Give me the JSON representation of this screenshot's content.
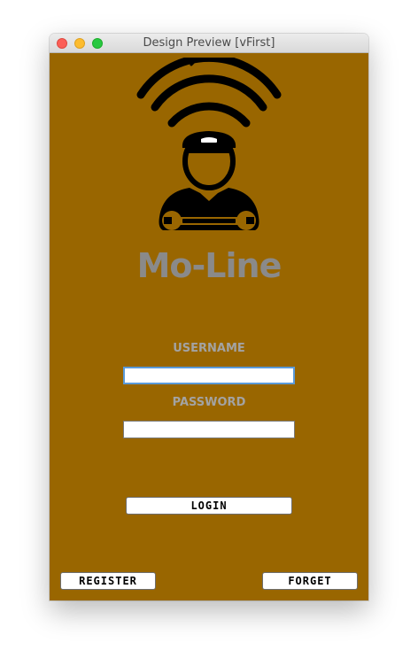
{
  "window": {
    "title": "Design Preview [vFirst]"
  },
  "app": {
    "name": "Mo-Line",
    "background_color": "#996600",
    "logo_icon": "mechanic-wifi-icon"
  },
  "form": {
    "username_label": "USERNAME",
    "username_value": "",
    "password_label": "PASSWORD",
    "password_value": "",
    "login_label": "LOGIN"
  },
  "footer": {
    "register_label": "REGISTER",
    "forget_label": "FORGET"
  }
}
